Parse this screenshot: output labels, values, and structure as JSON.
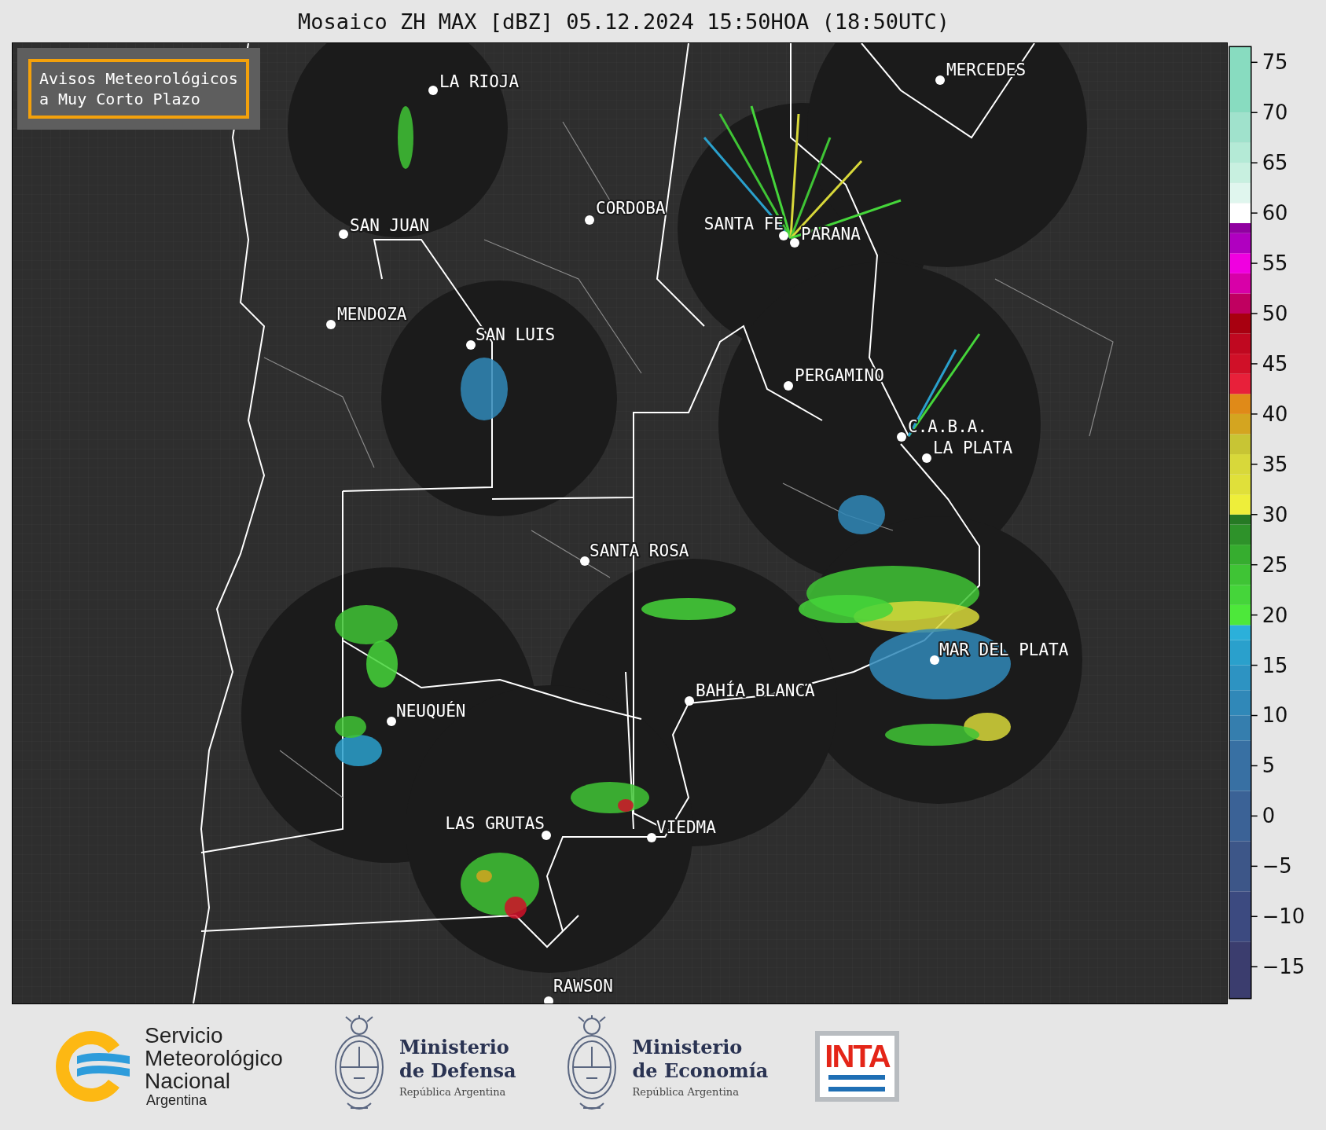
{
  "title": "Mosaico ZH MAX [dBZ] 05.12.2024 15:50HOA (18:50UTC)",
  "legend_box": {
    "lines": [
      "Avisos Meteorológicos",
      "a Muy Corto Plazo"
    ]
  },
  "map": {
    "cities": [
      {
        "name": "LA RIOJA"
      },
      {
        "name": "MERCEDES"
      },
      {
        "name": "CORDOBA"
      },
      {
        "name": "SAN JUAN"
      },
      {
        "name": "SANTA FE"
      },
      {
        "name": "PARANA"
      },
      {
        "name": "MENDOZA"
      },
      {
        "name": "SAN LUIS"
      },
      {
        "name": "PERGAMINO"
      },
      {
        "name": "C.A.B.A."
      },
      {
        "name": "LA PLATA"
      },
      {
        "name": "SANTA ROSA"
      },
      {
        "name": "MAR DEL PLATA"
      },
      {
        "name": "BAHÍA BLANCA"
      },
      {
        "name": "NEUQUÉN"
      },
      {
        "name": "LAS GRUTAS"
      },
      {
        "name": "VIEDMA"
      },
      {
        "name": "RAWSON"
      }
    ]
  },
  "colorbar": {
    "ticks": [
      "75",
      "70",
      "65",
      "60",
      "55",
      "50",
      "45",
      "40",
      "35",
      "30",
      "25",
      "20",
      "15",
      "10",
      "5",
      "0",
      "−5",
      "−10",
      "−15"
    ]
  },
  "footer": {
    "logos": [
      {
        "kind": "smn",
        "lines": [
          "Servicio",
          "Meteorológico",
          "Nacional"
        ],
        "subtitle": "Argentina"
      },
      {
        "kind": "ministry",
        "lines": [
          "Ministerio",
          "de Defensa"
        ],
        "subtitle": "República Argentina"
      },
      {
        "kind": "ministry",
        "lines": [
          "Ministerio",
          "de Economía"
        ],
        "subtitle": "República Argentina"
      },
      {
        "kind": "inta",
        "text": "INTA"
      }
    ]
  }
}
